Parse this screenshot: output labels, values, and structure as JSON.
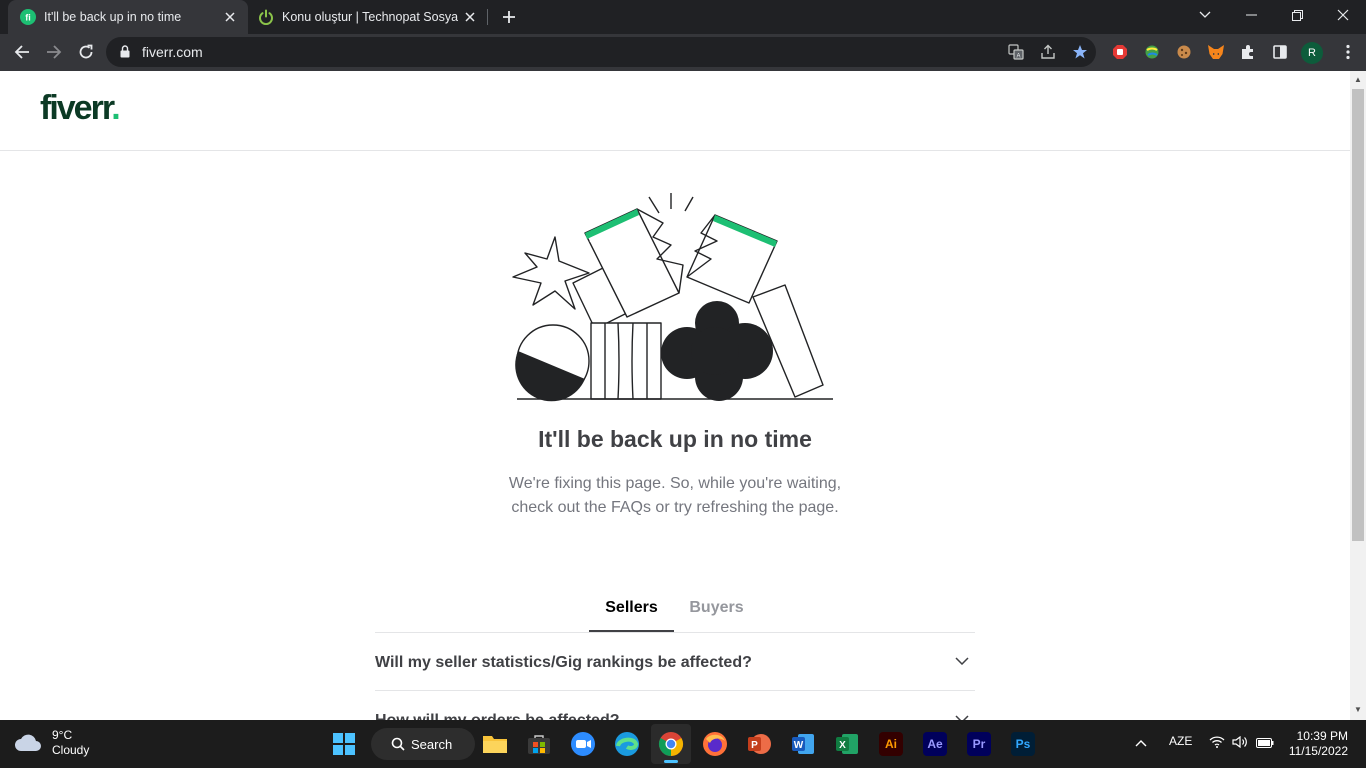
{
  "browser": {
    "tabs": [
      {
        "title": "It'll be back up in no time",
        "active": true
      },
      {
        "title": "Konu oluştur | Technopat Sosyal",
        "active": false
      }
    ],
    "url": "fiverr.com",
    "profile_initial": "R"
  },
  "site": {
    "logo_text": "fiverr",
    "logo_dot": ".",
    "brand_color": "#1dbf73",
    "logo_color": "#0c3a25"
  },
  "main": {
    "title": "It'll be back up in no time",
    "subtitle_line1": "We're fixing this page. So, while you're waiting,",
    "subtitle_line2": "check out the FAQs or try refreshing the page."
  },
  "faq": {
    "tabs": [
      {
        "label": "Sellers",
        "active": true
      },
      {
        "label": "Buyers",
        "active": false
      }
    ],
    "questions": [
      "Will my seller statistics/Gig rankings be affected?",
      "How will my orders be affected?"
    ]
  },
  "taskbar": {
    "weather_temp": "9°C",
    "weather_desc": "Cloudy",
    "search_label": "Search",
    "apps": [
      "Ai",
      "Ae",
      "Pr",
      "Ps"
    ],
    "language": "AZE",
    "time": "10:39 PM",
    "date": "11/15/2022"
  }
}
